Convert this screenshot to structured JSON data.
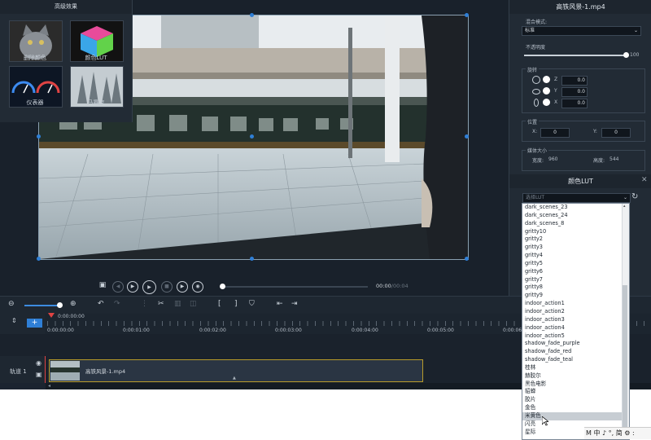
{
  "effects_panel": {
    "title": "高级效果",
    "items": [
      {
        "label": "删除颜色",
        "icon": "cat-thumbnail-icon"
      },
      {
        "label": "颜色LUT",
        "icon": "color-cube-icon"
      },
      {
        "label": "仪表器",
        "icon": "gauge-icon"
      },
      {
        "label": "马赛克",
        "icon": "forest-thumbnail-icon"
      }
    ]
  },
  "properties": {
    "title": "高铁风景-1.mp4",
    "blend_label": "混合模式:",
    "blend_value": "标准",
    "opacity_label": "不透明度",
    "opacity_value": "100",
    "rotate_label": "旋转",
    "rotate": [
      {
        "axis": "Z",
        "value": "0.0"
      },
      {
        "axis": "Y",
        "value": "0.0"
      },
      {
        "axis": "X",
        "value": "0.0"
      }
    ],
    "position_label": "位置",
    "pos_x_label": "X:",
    "pos_x": "0",
    "pos_y_label": "Y:",
    "pos_y": "0",
    "size_label": "媒体大小",
    "width_label": "宽度:",
    "width": "960",
    "height_label": "高度:",
    "height": "544"
  },
  "lut": {
    "title": "颜色LUT",
    "placeholder": "选择LUT",
    "items": [
      "dark_scenes_23",
      "dark_scenes_24",
      "dark_scenes_8",
      "gritty10",
      "gritty2",
      "gritty3",
      "gritty4",
      "gritty5",
      "gritty6",
      "gritty7",
      "gritty8",
      "gritty9",
      "indoor_action1",
      "indoor_action2",
      "indoor_action3",
      "indoor_action4",
      "indoor_action5",
      "shadow_fade_purple",
      "shadow_fade_red",
      "shadow_fade_teal",
      "桂林",
      "赫胶尔",
      "黑色电影",
      "貂蝉",
      "胶片",
      "金色",
      "米黄色",
      "闪亮",
      "星际"
    ],
    "selected": "米黄色"
  },
  "transport": {
    "time_current": "00:00",
    "time_total": "00:04"
  },
  "timeline": {
    "ruler_start": "0:00:00:00",
    "ticks": [
      "0:00:00:00",
      "0:00:01:00",
      "0:00:02:00",
      "0:00:03:00",
      "0:00:04:00",
      "0:00:05:00",
      "0:00:06:0"
    ],
    "track_label": "轨道 1",
    "clip_name": "高铁风景-1.mp4",
    "add_label": "+"
  },
  "ime_bar": "M 中 ♪ °, 简 ⚙ :"
}
